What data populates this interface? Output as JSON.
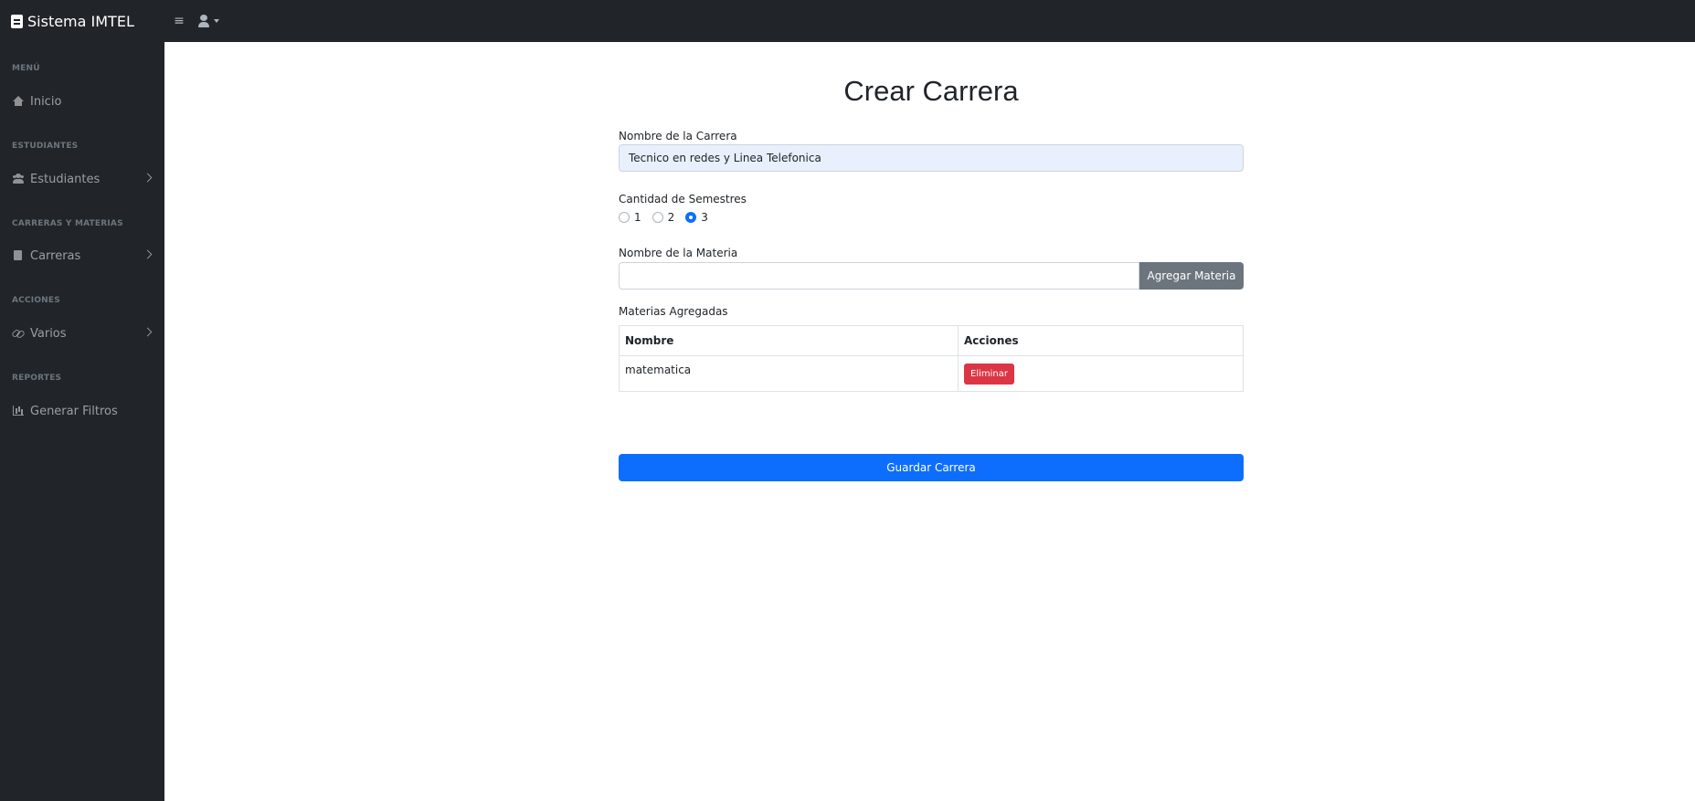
{
  "navbar": {
    "brand": "Sistema IMTEL",
    "toggle_glyph": "≡",
    "icons": [
      "book-icon",
      "menu-icon",
      "user-icon",
      "caret-down-icon"
    ]
  },
  "sidebar": {
    "sections": [
      {
        "heading": "MENÚ",
        "item": {
          "label": "Inicio",
          "icon": "home-icon",
          "expandable": false
        }
      },
      {
        "heading": "ESTUDIANTES",
        "item": {
          "label": "Estudiantes",
          "icon": "users-icon",
          "expandable": true
        }
      },
      {
        "heading": "CARRERAS Y MATERIAS",
        "item": {
          "label": "Carreras",
          "icon": "book-icon",
          "expandable": true
        }
      },
      {
        "heading": "ACCIONES",
        "item": {
          "label": "Varios",
          "icon": "link-icon",
          "expandable": true
        }
      },
      {
        "heading": "REPORTES",
        "item": {
          "label": "Generar Filtros",
          "icon": "chart-icon",
          "expandable": false
        }
      }
    ]
  },
  "form": {
    "title": "Crear Carrera",
    "career_name_label": "Nombre de la Carrera",
    "career_name_value": "Tecnico en redes y Linea Telefonica",
    "semesters_label": "Cantidad de Semestres",
    "semester_options": [
      "1",
      "2",
      "3"
    ],
    "semester_selected": "3",
    "subject_name_label": "Nombre de la Materia",
    "subject_name_value": "",
    "add_subject_button": "Agregar Materia",
    "added_subjects_label": "Materias Agregadas",
    "table": {
      "headers": [
        "Nombre",
        "Acciones"
      ],
      "rows": [
        {
          "name": "matematica",
          "action": "Eliminar"
        }
      ]
    },
    "save_button": "Guardar Carrera"
  },
  "colors": {
    "sidebar_bg": "#212529",
    "primary": "#0d6efd",
    "secondary": "#6c757d",
    "danger": "#dc3545",
    "autofill_bg": "#e8f0fe"
  }
}
